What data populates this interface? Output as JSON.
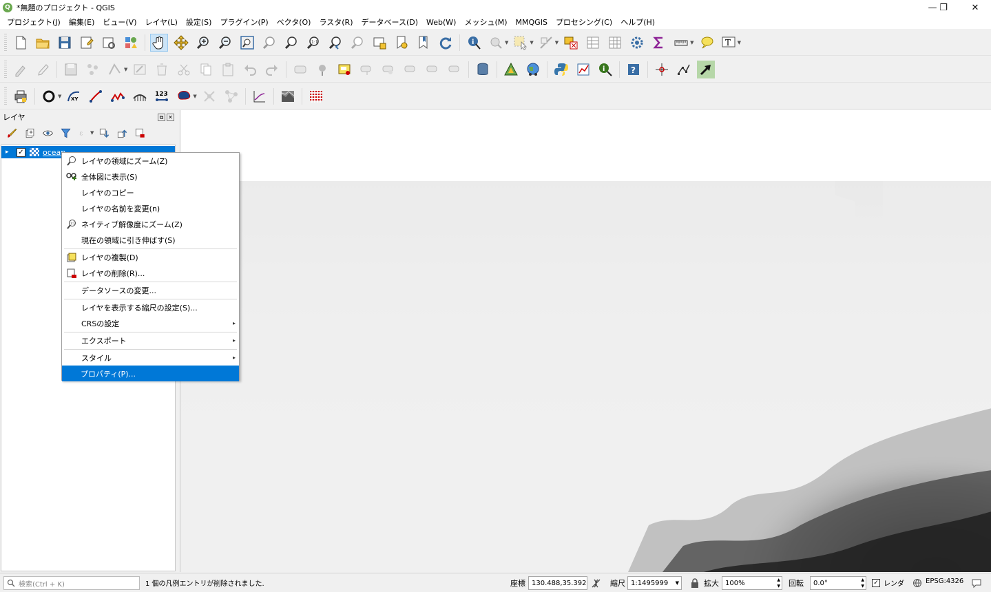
{
  "window": {
    "title": "*無題のプロジェクト - QGIS",
    "logo_letter": "Q",
    "minimize_glyph": "—",
    "restore_glyph": "❐",
    "close_glyph": "✕"
  },
  "menubar": {
    "items": [
      "プロジェクト(J)",
      "編集(E)",
      "ビュー(V)",
      "レイヤ(L)",
      "設定(S)",
      "プラグイン(P)",
      "ベクタ(O)",
      "ラスタ(R)",
      "データベース(D)",
      "Web(W)",
      "メッシュ(M)",
      "MMQGIS",
      "プロセシング(C)",
      "ヘルプ(H)"
    ]
  },
  "layers_panel": {
    "title": "レイヤ",
    "layer": {
      "name": "ocean",
      "checked": true,
      "expander": "▸",
      "check_glyph": "✓"
    },
    "header_btn_float": "⧉",
    "header_btn_close": "✕"
  },
  "context_menu": {
    "items": [
      {
        "label": "レイヤの領域にズーム(Z)",
        "icon": "zoom-layer-icon"
      },
      {
        "label": "全体図に表示(S)",
        "icon": "overview-icon"
      },
      {
        "label": "レイヤのコピー",
        "icon": ""
      },
      {
        "label": "レイヤの名前を変更(n)",
        "icon": ""
      },
      {
        "label": "ネイティブ解像度にズーム(Z)",
        "icon": "zoom-native-icon"
      },
      {
        "label": "現在の領域に引き伸ばす(S)",
        "icon": ""
      },
      {
        "label": "レイヤの複製(D)",
        "icon": "duplicate-layer-icon"
      },
      {
        "label": "レイヤの削除(R)...",
        "icon": "remove-layer-icon"
      },
      {
        "label": "データソースの変更...",
        "icon": ""
      },
      {
        "label": "レイヤを表示する縮尺の設定(S)...",
        "icon": ""
      },
      {
        "label": "CRSの設定",
        "icon": "",
        "submenu": true
      },
      {
        "label": "エクスポート",
        "icon": "",
        "submenu": true
      },
      {
        "label": "スタイル",
        "icon": "",
        "submenu": true
      },
      {
        "label": "プロパティ(P)...",
        "icon": "",
        "selected": true
      }
    ],
    "submenu_arrow": "▸"
  },
  "statusbar": {
    "search_placeholder": "検索(Ctrl + K)",
    "message": "1 個の凡例エントリが削除されました.",
    "coord_label": "座標",
    "coord_value": "130.488,35.392",
    "scale_label": "縮尺",
    "scale_value": "1:1495999",
    "magnifier_label": "拡大",
    "magnifier_value": "100%",
    "rotation_label": "回転",
    "rotation_value": "0.0°",
    "render_label": "レンダ",
    "render_checked": true,
    "crs_label": "EPSG:4326",
    "spin_up": "▲",
    "spin_down": "▼",
    "dropdown_glyph": "▼"
  },
  "colors": {
    "selection": "#0078d7",
    "window_bg": "#f0f0f0",
    "canvas_bg": "#ffffff"
  }
}
